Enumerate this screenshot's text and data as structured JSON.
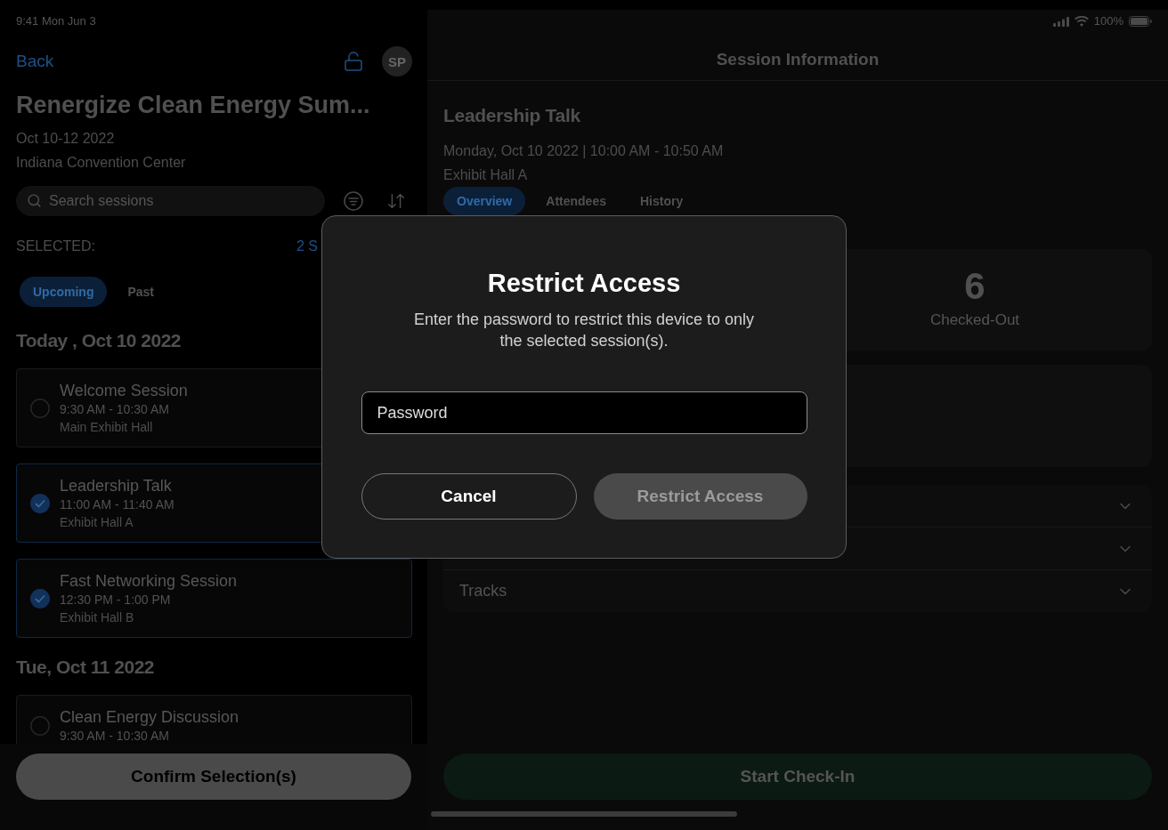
{
  "status_bar": {
    "time": "9:41 Mon Jun 3",
    "battery": "100%"
  },
  "event_panel": {
    "back": "Back",
    "avatar": "SP",
    "title": "Renergize Clean Energy Sum...",
    "dates": "Oct 10-12 2022",
    "venue": "Indiana Convention Center",
    "search": {
      "placeholder": "Search sessions"
    },
    "selected_label": "SELECTED:",
    "selected_count": "2 S",
    "filters": [
      {
        "label": "Upcoming",
        "selected": true
      },
      {
        "label": "Past",
        "selected": false
      }
    ],
    "days": [
      {
        "heading": "Today , Oct 10 2022",
        "sessions": [
          {
            "title": "Welcome Session",
            "time": "9:30 AM - 10:30 AM",
            "location": "Main Exhibit Hall",
            "selected": false
          },
          {
            "title": "Leadership Talk",
            "time": "11:00 AM - 11:40 AM",
            "location": "Exhibit Hall A",
            "selected": true
          },
          {
            "title": "Fast Networking Session",
            "time": "12:30 PM - 1:00 PM",
            "location": "Exhibit Hall B",
            "selected": true
          }
        ]
      },
      {
        "heading": "Tue, Oct 11 2022",
        "sessions": [
          {
            "title": "Clean Energy Discussion",
            "time": "9:30 AM - 10:30 AM",
            "selected": false
          }
        ]
      }
    ],
    "confirm_button": "Confirm Selection(s)"
  },
  "session_panel": {
    "header": "Session Information",
    "title": "Leadership Talk",
    "schedule": "Monday, Oct 10 2022 | 10:00 AM - 10:50 AM",
    "room": "Exhibit Hall A",
    "tabs": [
      {
        "label": "Overview",
        "selected": true
      },
      {
        "label": "Attendees",
        "selected": false
      },
      {
        "label": "History",
        "selected": false
      }
    ],
    "stat": {
      "value": "6",
      "label": "Checked-Out"
    },
    "sections": [
      {
        "expanded": false
      },
      {
        "expanded": false
      },
      {
        "label": "Tracks",
        "expanded": false
      }
    ],
    "start_button": "Start Check-In"
  },
  "dialog": {
    "title": "Restrict Access",
    "message": "Enter the password to restrict this device to only the selected session(s).",
    "password": {
      "placeholder": "Password"
    },
    "buttons": [
      {
        "label": "Cancel",
        "kind": "secondary",
        "disabled": false
      },
      {
        "label": "Restrict Access",
        "kind": "primary",
        "disabled": true
      }
    ]
  }
}
